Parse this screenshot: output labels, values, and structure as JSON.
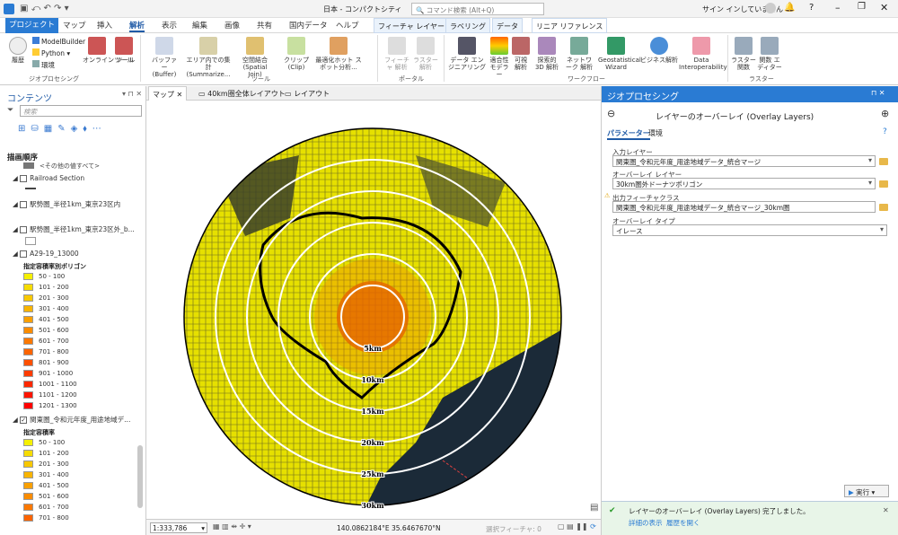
{
  "titlebar": {
    "quick": "プロジェクト",
    "title": "日本 - コンパクトシティ",
    "search_placeholder": "コマンド検索 (Alt+Q)",
    "signin": "サイン インしていません"
  },
  "ribbon_tabs": [
    "プロジェクト",
    "マップ",
    "挿入",
    "解析",
    "表示",
    "編集",
    "画像",
    "共有",
    "国内データ",
    "ヘルプ"
  ],
  "context_tabs": [
    "フィーチャ レイヤー",
    "ラベリング",
    "データ",
    "リニア リファレンス"
  ],
  "ribbon": {
    "geoprocessing_group": "ジオプロセシング",
    "tools_group": "ツール",
    "portal_group": "ポータル",
    "workflow_group": "ワークフロー",
    "raster_group": "ラスター",
    "history": "履歴",
    "modelbuilder": "ModelBuilder",
    "python": "Python",
    "env": "環境",
    "online": "オンライン ツール",
    "tools": "ツール",
    "buffer": "バッファー (Buffer)",
    "summarize": "エリア内での集計 (Summarize...",
    "spatial_join": "空間結合 (Spatial Join)",
    "clip": "クリップ (Clip)",
    "hotspot": "最適化ホット スポット分析...",
    "feature_analysis": "フィーチャ 解析",
    "raster_analysis": "ラスター 解析",
    "data_engineering": "データ エンジニアリング",
    "suitability": "適合性 モデラー",
    "visibility": "可視 解析",
    "exploratory": "探索的 3D 解析",
    "network": "ネットワーク 解析",
    "geostat": "Geostatistical Wizard",
    "business": "ビジネス解析",
    "interop": "Data Interoperability",
    "raster_func": "ラスター 関数",
    "func_editor": "関数 エディター"
  },
  "contents": {
    "title": "コンテンツ",
    "search_placeholder": "検索",
    "drawing_order": "描画順序",
    "other_values": "<その他の値すべて>",
    "layers": [
      "Railroad Section",
      "駅勢圏_半径1km_東京23区内",
      "駅勢圏_半径1km_東京23区外_b...",
      "A29-19_13000",
      "関東圏_令和元年度_用途地域デ..."
    ],
    "legend1_title": "指定容積率別ポリゴン",
    "legend1": [
      "50 - 100",
      "101 - 200",
      "201 - 300",
      "301 - 400",
      "401 - 500",
      "501 - 600",
      "601 - 700",
      "701 - 800",
      "801 - 900",
      "901 - 1000",
      "1001 - 1100",
      "1101 - 1200",
      "1201 - 1300"
    ],
    "legend1_colors": [
      "#f5f000",
      "#f6dc00",
      "#f7c800",
      "#f8b400",
      "#f9a000",
      "#fa8c00",
      "#fb7800",
      "#fb6400",
      "#fc5000",
      "#fc3c00",
      "#fd2800",
      "#fe1400",
      "#ff0000"
    ],
    "legend2_title": "指定容積率",
    "legend2": [
      "50 - 100",
      "101 - 200",
      "201 - 300",
      "301 - 400",
      "401 - 500",
      "501 - 600",
      "601 - 700",
      "701 - 800"
    ],
    "legend2_colors": [
      "#f5f000",
      "#f6dc00",
      "#f7c800",
      "#f8b400",
      "#f9a000",
      "#fa8c00",
      "#fb7800",
      "#fb6400"
    ]
  },
  "map": {
    "tabs": [
      "マップ",
      "40km圏全体レイアウト",
      "レイアウト"
    ],
    "ring_labels": [
      "5km",
      "10km",
      "15km",
      "20km",
      "25km",
      "30km"
    ],
    "scale": "1:333,786",
    "coords": "140.0862184°E 35.6467670°N",
    "selected": "選択フィーチャ: 0"
  },
  "geo": {
    "title": "ジオプロセシング",
    "tool_title": "レイヤーのオーバーレイ (Overlay Layers)",
    "tab_params": "パラメーター",
    "tab_env": "環境",
    "input_label": "入力レイヤー",
    "input_value": "関東圏_令和元年度_用途地域データ_統合マージ",
    "overlay_label": "オーバーレイ レイヤー",
    "overlay_value": "30km圏外ドーナツポリゴン",
    "output_label": "出力フィーチャクラス",
    "output_value": "関東圏_令和元年度_用途地域データ_統合マージ_30km圏",
    "type_label": "オーバーレイ タイプ",
    "type_value": "イレース",
    "run": "実行",
    "status": "レイヤーのオーバーレイ (Overlay Layers) 完了しました。",
    "details": "詳細の表示",
    "history": "履歴を開く"
  }
}
